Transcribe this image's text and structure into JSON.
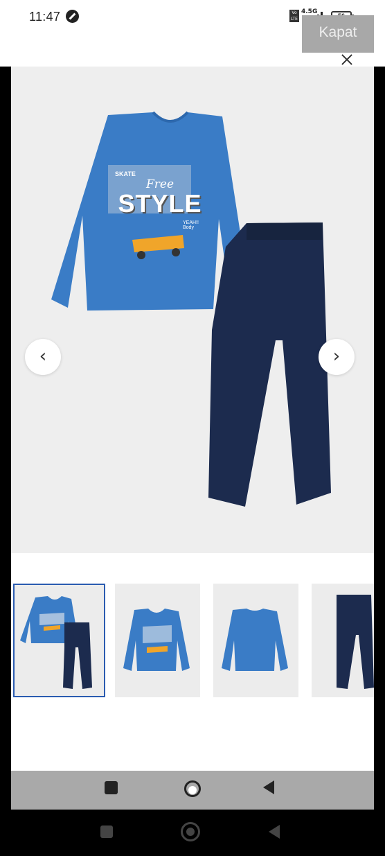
{
  "status_bar": {
    "time": "11:47",
    "network_badge": "Vo LTE",
    "network_type": "4.5G",
    "battery": "56"
  },
  "overlay": {
    "kapat_label": "Kapat"
  },
  "gallery": {
    "prev_arrow": "‹",
    "next_arrow": "›",
    "thumbnails": [
      "set",
      "shirt-front",
      "shirt-back",
      "pants"
    ],
    "active_index": 0
  },
  "product_print": {
    "small_badge": "SKATE",
    "line1": "Free",
    "line2": "Style",
    "side_text": "YEAH!! Body"
  },
  "colors": {
    "shirt": "#3a7cc6",
    "pants": "#1c2b4e",
    "skateboard": "#f0a52a",
    "active_border": "#2a5bb0",
    "navbar_grey": "#a9a9a9"
  },
  "navigation": {
    "icons": [
      "recent-apps-icon",
      "home-icon",
      "back-icon"
    ]
  }
}
